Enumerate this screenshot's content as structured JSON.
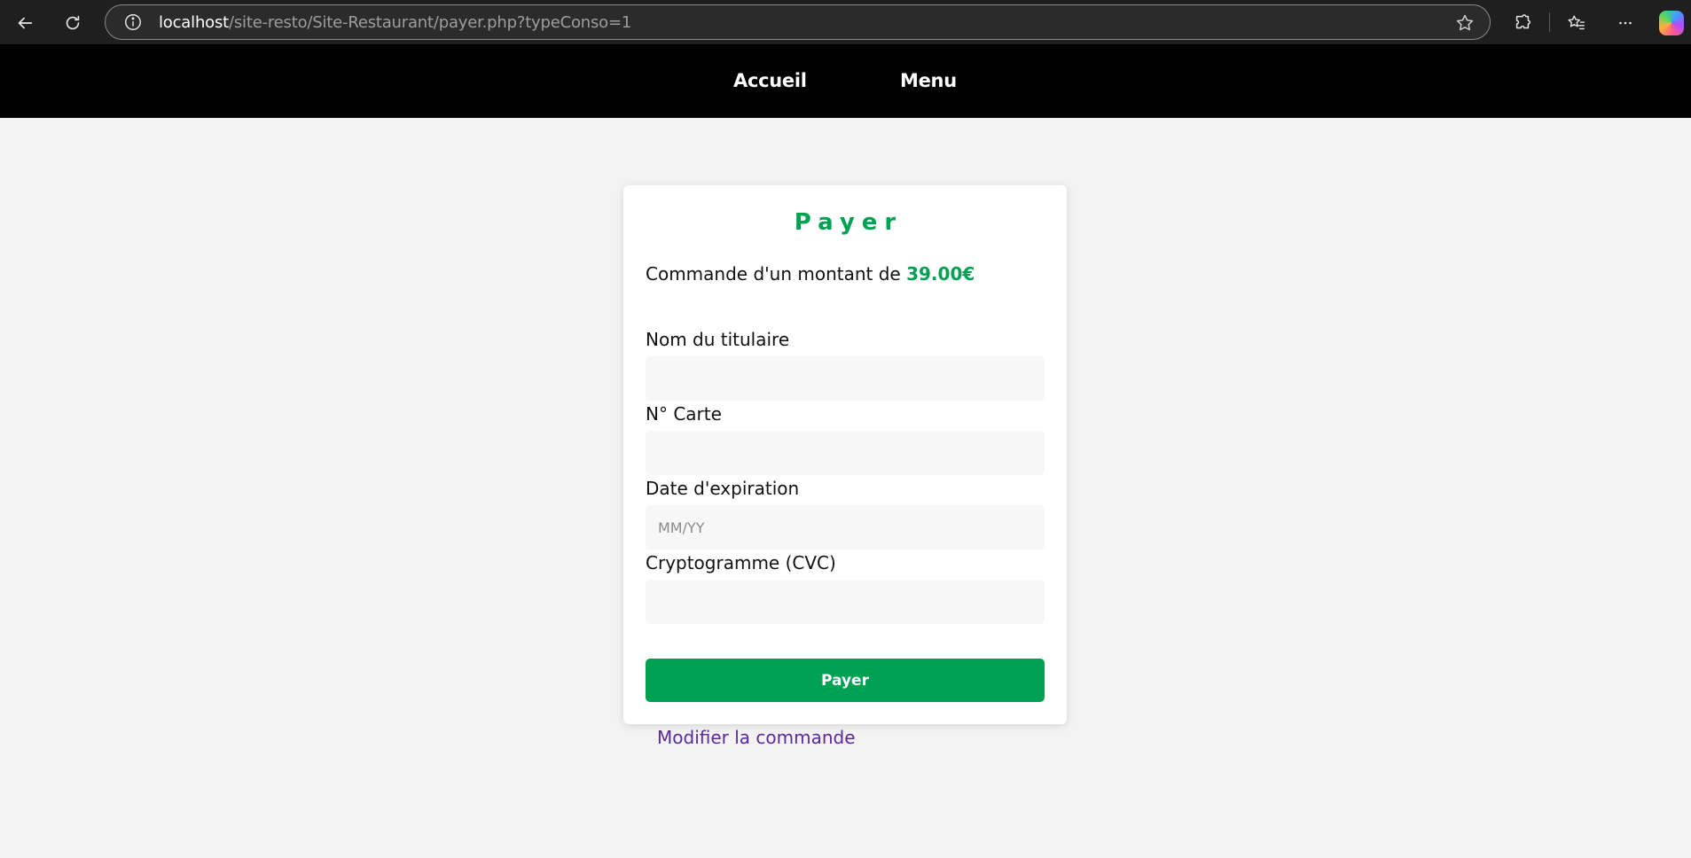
{
  "browser": {
    "url_host": "localhost",
    "url_path": "/site-resto/Site-Restaurant/payer.php?typeConso=1"
  },
  "nav": {
    "items": [
      {
        "label": "Accueil"
      },
      {
        "label": "Menu"
      }
    ]
  },
  "payment": {
    "title": "Payer",
    "amount_prefix": "Commande d'un montant de ",
    "amount_value": "39.00€",
    "fields": {
      "holder_label": "Nom du titulaire",
      "holder_value": "",
      "card_label": "N° Carte",
      "card_value": "",
      "expiry_label": "Date d'expiration",
      "expiry_placeholder": "MM/YY",
      "cvc_label": "Cryptogramme (CVC)",
      "cvc_value": ""
    },
    "submit_label": "Payer",
    "modify_link": "Modifier la commande"
  },
  "colors": {
    "accent_green": "#00a152",
    "nav_bg": "#000000",
    "page_bg": "#f3f3f3",
    "link_purple": "#5b2a9a"
  },
  "icons": [
    "back-arrow-icon",
    "refresh-icon",
    "info-icon",
    "star-icon",
    "extensions-icon",
    "favorites-icon",
    "more-icon",
    "copilot-icon"
  ]
}
